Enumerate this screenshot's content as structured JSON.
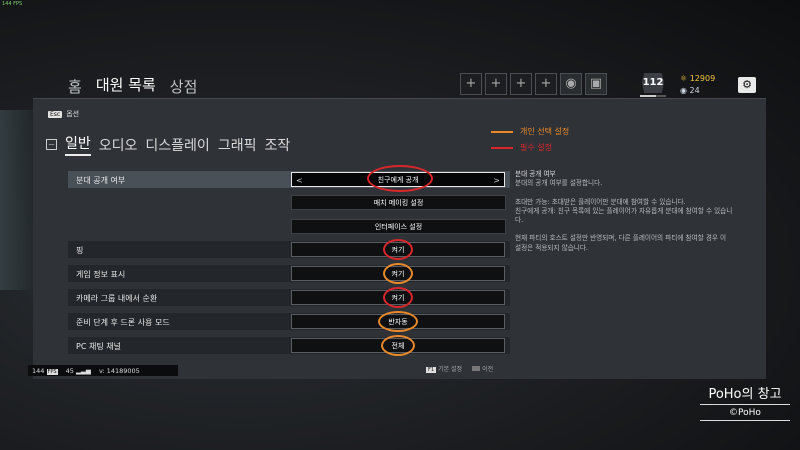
{
  "fps": "144 FPS",
  "top_tabs": [
    "홈",
    "대원 목록",
    "상점"
  ],
  "top_active": 1,
  "slots": [
    "+",
    "+",
    "+",
    "+"
  ],
  "player": {
    "level": "112",
    "level_progress": 0.6,
    "credits": "12909",
    "renown": "24"
  },
  "back": {
    "key": "Esc",
    "label": "옵션"
  },
  "subtabs": [
    "일반",
    "오디오",
    "디스플레이",
    "그래픽",
    "조작"
  ],
  "legend": [
    {
      "label": "개인 선택 설정",
      "color": "#e9892a"
    },
    {
      "label": "필수 설정",
      "color": "#d8262b"
    }
  ],
  "squad_row": {
    "label": "분대 공개 여부",
    "value": "친구에게 공개",
    "left_arrow": "<",
    "right_arrow": ">"
  },
  "buttons": {
    "matchmaking": "매치 메이킹 설정",
    "interface": "인터페이스 설정"
  },
  "rows": [
    {
      "label": "핑",
      "value": "켜기"
    },
    {
      "label": "게임 정보 표시",
      "value": "켜기"
    },
    {
      "label": "카메라 그룹 내에서 순환",
      "value": "켜기"
    },
    {
      "label": "준비 단계 후 드론 사용 모드",
      "value": "반자동"
    },
    {
      "label": "PC 채팅 채널",
      "value": "전체"
    }
  ],
  "description": {
    "title": "분대 공개 여부",
    "lines": [
      "분대의 공개 여부를 설정합니다.",
      "",
      "초대만 가능: 초대받은 플레이어만 분대에 참여할 수 있습니다.",
      "친구에게 공개: 친구 목록에 있는 플레이어가 자유롭게 분대에 참여할 수 있습니다.",
      "",
      "현재 파티의 호스트 설정만 반영되며, 다른 플레이어의 파티에 참여할 경우 이 설정은 적용되지 않습니다."
    ]
  },
  "status": {
    "fps": "144",
    "fps_badge": "FPS",
    "ping": "45",
    "version": "v:  14189005"
  },
  "footer": {
    "f_key": "F1",
    "f_label": "기본 설정",
    "alt_label": "이전"
  },
  "watermark": {
    "line1": "PoHo의 창고",
    "line2": "©PoHo"
  },
  "colors": {
    "must": "#d8262b",
    "personal": "#e9892a",
    "panel": "#2f3237"
  }
}
